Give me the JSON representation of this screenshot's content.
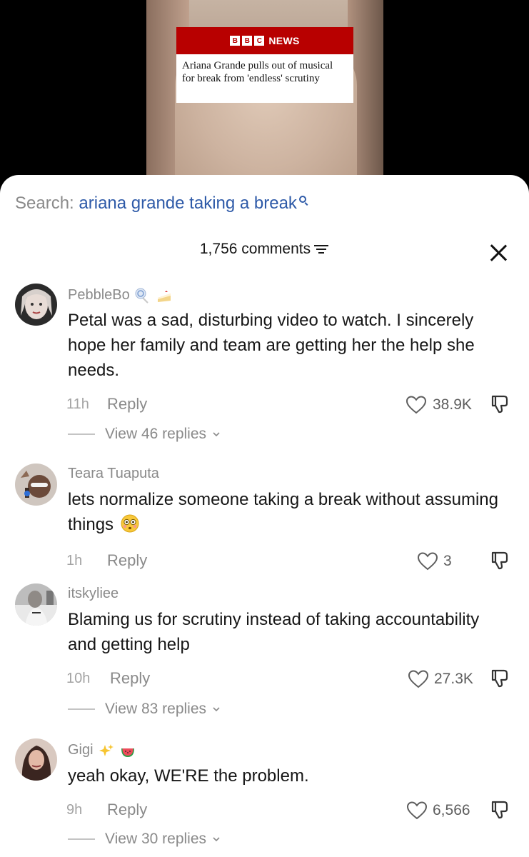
{
  "video": {
    "bbc_letters": [
      "B",
      "B",
      "C"
    ],
    "bbc_news_label": "NEWS",
    "headline": "Ariana Grande pulls out of musical for break from 'endless' scrutiny"
  },
  "search": {
    "label": "Search:",
    "query": "ariana grande taking a break"
  },
  "header": {
    "comment_count": "1,756 comments"
  },
  "comments": [
    {
      "username": "PebbleBo",
      "badges": [
        "lollipop-icon",
        "cake-icon"
      ],
      "text": "Petal was a sad, disturbing video to watch. I sincerely hope her family and team are getting her the help she needs.",
      "time": "11h",
      "reply_label": "Reply",
      "likes": "38.9K",
      "view_replies": "View 46 replies"
    },
    {
      "username": "Teara Tuaputa",
      "text": "lets normalize someone taking a break without assuming things",
      "text_emoji": "flushed-face-icon",
      "time": "1h",
      "reply_label": "Reply",
      "likes": "3"
    },
    {
      "username": "itskyliee",
      "text": "Blaming us for scrutiny instead of taking accountability and getting help",
      "time": "10h",
      "reply_label": "Reply",
      "likes": "27.3K",
      "view_replies": "View 83 replies"
    },
    {
      "username": "Gigi",
      "badges": [
        "sparkles-icon",
        "watermelon-icon"
      ],
      "text": "yeah okay, WE'RE the problem.",
      "time": "9h",
      "reply_label": "Reply",
      "likes": "6,566",
      "view_replies": "View 30 replies"
    }
  ],
  "colors": {
    "bbc_red": "#b80000",
    "search_query": "#2e5aa8",
    "muted_text": "#8a8a8a"
  }
}
